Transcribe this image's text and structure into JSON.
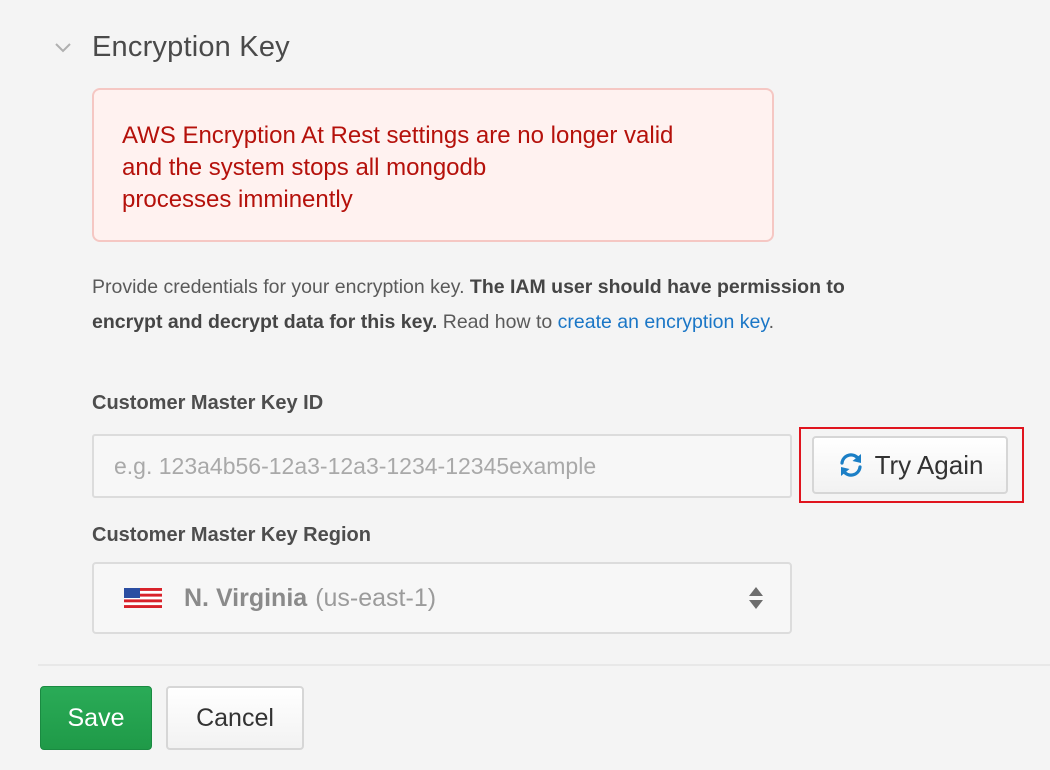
{
  "section": {
    "title": "Encryption Key",
    "chevron_icon": "chevron-down-icon"
  },
  "alert": {
    "message": "AWS Encryption At Rest settings are no longer valid\nand the system stops all mongodb\nprocesses imminently",
    "color": "#b5110b",
    "background": "#fff2f0"
  },
  "description": {
    "part1": "Provide credentials for your encryption key. ",
    "bold": "The IAM user should have permission to encrypt and decrypt data for this key.",
    "part2": " Read how to ",
    "link": "create an encryption key",
    "end": "."
  },
  "key_id": {
    "label": "Customer Master Key ID",
    "placeholder": "e.g. 123a4b56-12a3-12a3-1234-12345example",
    "value": ""
  },
  "try_again": {
    "label": "Try Again",
    "icon": "refresh-icon"
  },
  "region": {
    "label": "Customer Master Key Region",
    "selected_name": "N. Virginia",
    "selected_code": "(us-east-1)",
    "flag_icon": "us-flag-icon"
  },
  "actions": {
    "save_label": "Save",
    "cancel_label": "Cancel",
    "save_color": "#1f9a48"
  }
}
